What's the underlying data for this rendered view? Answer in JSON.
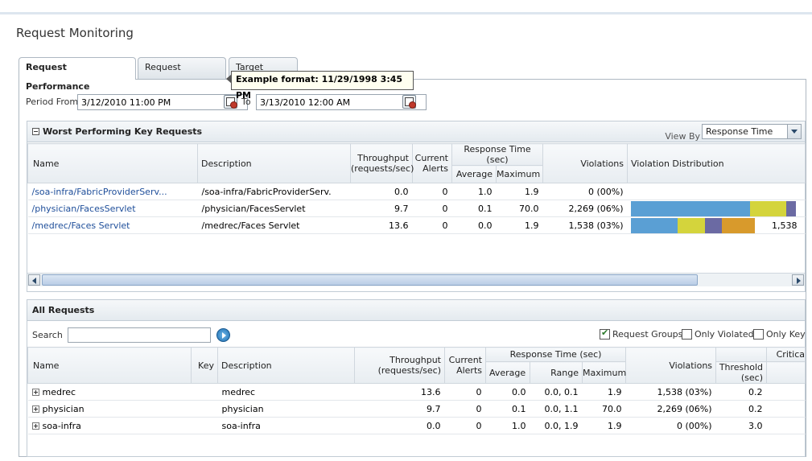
{
  "page": {
    "title": "Request Monitoring"
  },
  "tabs": [
    {
      "label": "Request Performance",
      "active": true
    },
    {
      "label": "Request Definitions",
      "active": false
    },
    {
      "label": "Target Setup",
      "active": false
    }
  ],
  "tooltip": {
    "text": "Example format: 11/29/1998 3:45 PM"
  },
  "period": {
    "from_label": "Period From",
    "from_value": "3/12/2010 11:00 PM",
    "to_label": "To",
    "to_value": "3/13/2010 12:00 AM"
  },
  "worst": {
    "title": "Worst Performing Key Requests",
    "view_by_label": "View By",
    "view_by_value": "Response Time",
    "headers": {
      "name": "Name",
      "description": "Description",
      "throughput": "Throughput (requests/sec)",
      "alerts": "Current Alerts",
      "response_time": "Response Time (sec)",
      "average": "Average",
      "maximum": "Maximum",
      "violations": "Violations",
      "distribution": "Violation Distribution"
    },
    "rows": [
      {
        "name": "/soa-infra/FabricProviderServ...",
        "description": "/soa-infra/FabricProviderServ.",
        "throughput": "0.0",
        "alerts": "0",
        "average": "1.0",
        "maximum": "1.9",
        "violations": "0 (00%)",
        "dist_label": "",
        "segments": []
      },
      {
        "name": "/physician/FacesServlet",
        "description": "/physician/FacesServlet",
        "throughput": "9.7",
        "alerts": "0",
        "average": "0.1",
        "maximum": "70.0",
        "violations": "2,269 (06%)",
        "dist_label": "",
        "segments": [
          {
            "color": "#5a9fd4",
            "fraction": 0.72
          },
          {
            "color": "#d4d43c",
            "fraction": 0.22
          },
          {
            "color": "#6b6aa3",
            "fraction": 0.06
          }
        ]
      },
      {
        "name": "/medrec/Faces Servlet",
        "description": "/medrec/Faces Servlet",
        "throughput": "13.6",
        "alerts": "0",
        "average": "0.0",
        "maximum": "1.9",
        "violations": "1,538 (03%)",
        "dist_label": "1,538",
        "segments": [
          {
            "color": "#5a9fd4",
            "fraction": 0.34
          },
          {
            "color": "#d4d43c",
            "fraction": 0.2
          },
          {
            "color": "#6b6aa3",
            "fraction": 0.12
          },
          {
            "color": "#d89a2c",
            "fraction": 0.24
          }
        ]
      }
    ]
  },
  "all": {
    "title": "All Requests",
    "search_label": "Search",
    "search_value": "",
    "checkboxes": [
      {
        "label": "Request Groups",
        "checked": true
      },
      {
        "label": "Only Violated",
        "checked": false
      },
      {
        "label": "Only Key",
        "checked": false
      }
    ],
    "headers": {
      "name": "Name",
      "key": "Key",
      "description": "Description",
      "throughput": "Throughput (requests/sec)",
      "alerts": "Current Alerts",
      "response_time": "Response Time (sec)",
      "average": "Average",
      "range": "Range",
      "maximum": "Maximum",
      "violations": "Violations",
      "critical": "Critica",
      "threshold": "Threshold (sec)"
    },
    "rows": [
      {
        "name": "medrec",
        "key": "",
        "description": "medrec",
        "throughput": "13.6",
        "alerts": "0",
        "average": "0.0",
        "range": "0.0, 0.1",
        "maximum": "1.9",
        "violations": "1,538 (03%)",
        "threshold": "0.2"
      },
      {
        "name": "physician",
        "key": "",
        "description": "physician",
        "throughput": "9.7",
        "alerts": "0",
        "average": "0.1",
        "range": "0.0, 1.1",
        "maximum": "70.0",
        "violations": "2,269 (06%)",
        "threshold": "0.2"
      },
      {
        "name": "soa-infra",
        "key": "",
        "description": "soa-infra",
        "throughput": "0.0",
        "alerts": "0",
        "average": "1.0",
        "range": "0.0, 1.9",
        "maximum": "1.9",
        "violations": "0 (00%)",
        "threshold": "3.0"
      }
    ]
  }
}
